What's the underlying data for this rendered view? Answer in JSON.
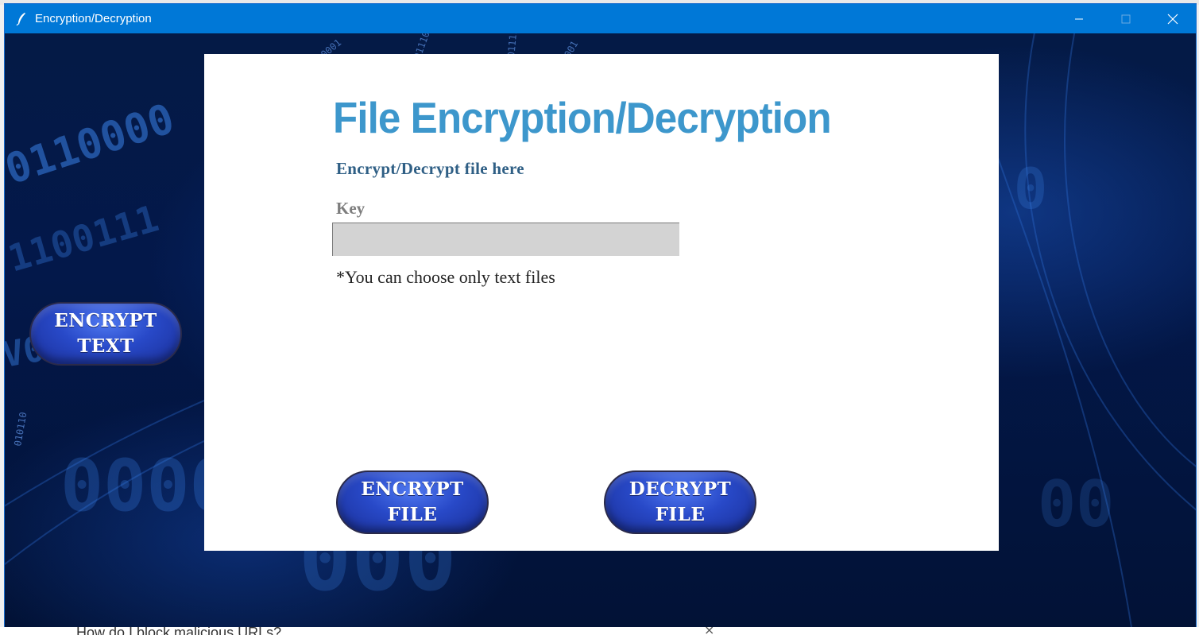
{
  "window": {
    "title": "Encryption/Decryption",
    "controls": {
      "minimize": "minimize-icon",
      "maximize": "maximize-icon",
      "close": "close-icon"
    },
    "title_bar_color": "#0078d7"
  },
  "behind": {
    "bottom_text": "How do I block malicious URLs?",
    "bottom_close": "×"
  },
  "panel": {
    "title": "File Encryption/Decryption",
    "subtitle": "Encrypt/Decrypt file here",
    "key_label": "Key",
    "key_value": "",
    "note": "*You can choose only text files"
  },
  "buttons": {
    "encrypt_text": [
      "ENCRYPT",
      "TEXT"
    ],
    "encrypt_file": [
      "ENCRYPT",
      "FILE"
    ],
    "decrypt_file": [
      "DECRYPT",
      "FILE"
    ]
  },
  "colors": {
    "heading": "#3d97cc",
    "button": "#2849c8",
    "background": "#041a46"
  }
}
